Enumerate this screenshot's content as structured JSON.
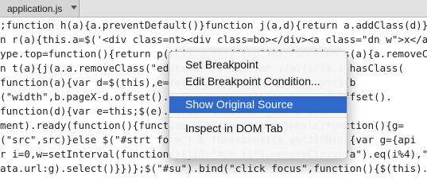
{
  "tab": {
    "title": "application.js",
    "menu_icon": "chevron-down-icon"
  },
  "code_lines": [
    ";function h(a){a.preventDefault()}function j(a,d){return a.addClass(d)}window.pd=",
    "n r(a){this.a=$('<div class=nt><div class=bo></div><a class=\"dn w\">x</a><div class=",
    "ype.top=function(){return p(this.a.css(\"top\"))};function s(a){a.removeClass(\"re",
    "n t(a){j(a.a.removeClass(\"editable\")}function i(a){if(a.a.hasClass(",
    "function(a){var d=$(this),e=false)}function(b){b.target=$(b",
    "(\"width\",b.pageX-d.offset().left)}function(b){b.pageY-d.offset().",
    "function(d){var e=this;$(e).hover(function(){var b=d(th",
    "ment).ready(function(){function a(){var e=false}while(function(){g=",
    "(\"src\",src)}else $(\"#strt form\").b function(){$.getJSON(u){var g={api",
    "r i=0,w=setInterval(function(){j($(\"#id li\").removeClass(\"a\").eq(i%4),\"a\");i++},50",
    "ata.url:g).select()}})};$(\"#su\").bind(\"click focus\",function(){$(this).select()})"
  ],
  "context_menu": {
    "items": [
      {
        "label": "Set Breakpoint",
        "selected": false
      },
      {
        "label": "Edit Breakpoint Condition...",
        "selected": false
      },
      {
        "label": "Show Original Source",
        "selected": true
      },
      {
        "label": "Inspect in DOM Tab",
        "selected": false
      }
    ],
    "selected_color": "#2f69cc"
  },
  "colors": {
    "editor_background": "#ffffff",
    "code_text": "#1e1e1e",
    "menu_highlight": "#2f69cc"
  }
}
